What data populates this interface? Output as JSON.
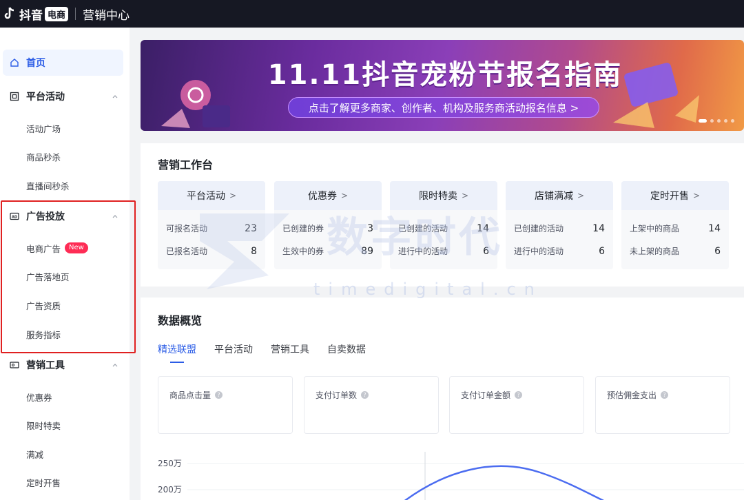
{
  "topbar": {
    "brand": "抖音",
    "brand_badge": "电商",
    "title": "营销中心"
  },
  "sidebar": {
    "home": "首页",
    "groups": [
      {
        "label": "平台活动",
        "items": [
          "活动广场",
          "商品秒杀",
          "直播间秒杀"
        ]
      },
      {
        "label": "广告投放",
        "items": [
          "电商广告",
          "广告落地页",
          "广告资质",
          "服务指标"
        ]
      },
      {
        "label": "营销工具",
        "items": [
          "优惠券",
          "限时特卖",
          "满减",
          "定时开售"
        ]
      }
    ],
    "new_badge": "New"
  },
  "banner": {
    "title": "11.11抖音宠粉节报名指南",
    "cta": "点击了解更多商家、创作者、机构及服务商活动报名信息 >"
  },
  "workbench": {
    "title": "营销工作台",
    "tiles": [
      {
        "head": "平台活动",
        "rows": [
          {
            "label": "可报名活动",
            "value": "23"
          },
          {
            "label": "已报名活动",
            "value": "8"
          }
        ]
      },
      {
        "head": "优惠券",
        "rows": [
          {
            "label": "已创建的券",
            "value": "3"
          },
          {
            "label": "生效中的券",
            "value": "89"
          }
        ]
      },
      {
        "head": "限时特卖",
        "rows": [
          {
            "label": "已创建的活动",
            "value": "14"
          },
          {
            "label": "进行中的活动",
            "value": "6"
          }
        ]
      },
      {
        "head": "店铺满减",
        "rows": [
          {
            "label": "已创建的活动",
            "value": "14"
          },
          {
            "label": "进行中的活动",
            "value": "6"
          }
        ]
      },
      {
        "head": "定时开售",
        "rows": [
          {
            "label": "上架中的商品",
            "value": "14"
          },
          {
            "label": "未上架的商品",
            "value": "6"
          }
        ]
      }
    ]
  },
  "overview": {
    "title": "数据概览",
    "tabs": [
      "精选联盟",
      "平台活动",
      "营销工具",
      "自卖数据"
    ],
    "metrics": [
      "商品点击量",
      "支付订单数",
      "支付订单金额",
      "预估佣金支出"
    ],
    "chart_ticks": [
      "250万",
      "200万"
    ]
  },
  "watermark": {
    "main": "数字时代",
    "sub": "timedigital.cn"
  }
}
